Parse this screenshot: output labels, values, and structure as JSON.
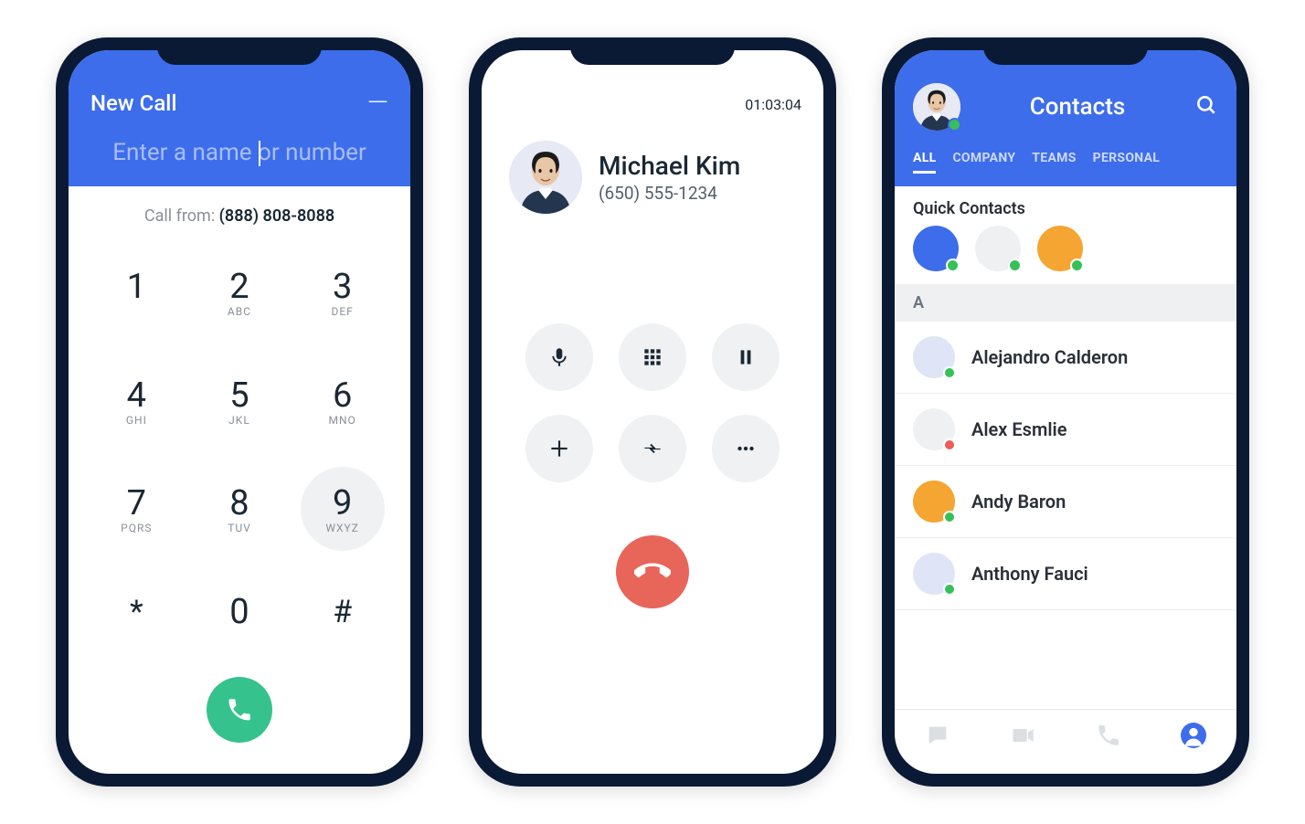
{
  "colors": {
    "brand": "#3D6DEB",
    "callGreen": "#36c28c",
    "hangRed": "#e8655a",
    "presenceGreen": "#36c158",
    "presenceRed": "#ef5a5a",
    "contactOrange": "#f5a531",
    "contactBlue": "#3D6DEB",
    "contactPale": "#dfe4f7",
    "contactGray": "#eef0f2"
  },
  "phone1": {
    "title": "New Call",
    "minimizeGlyph": "—",
    "inputPlaceholder": "Enter a name or number",
    "callFromLabel": "Call from:",
    "callFromNumber": "(888) 808-8088",
    "keys": [
      {
        "digit": "1",
        "letters": ""
      },
      {
        "digit": "2",
        "letters": "ABC"
      },
      {
        "digit": "3",
        "letters": "DEF"
      },
      {
        "digit": "4",
        "letters": "GHI"
      },
      {
        "digit": "5",
        "letters": "JKL"
      },
      {
        "digit": "6",
        "letters": "MNO"
      },
      {
        "digit": "7",
        "letters": "PQRS"
      },
      {
        "digit": "8",
        "letters": "TUV"
      },
      {
        "digit": "9",
        "letters": "WXYZ",
        "highlighted": true
      },
      {
        "digit": "*",
        "letters": "",
        "symbol": true
      },
      {
        "digit": "0",
        "letters": ""
      },
      {
        "digit": "#",
        "letters": "",
        "symbol": true
      }
    ],
    "callButtonIcon": "phone-icon"
  },
  "phone2": {
    "timer": "01:03:04",
    "contactName": "Michael Kim",
    "contactPhone": "(650) 555-1234",
    "controls": [
      {
        "name": "mute-button",
        "icon": "mic-icon"
      },
      {
        "name": "keypad-button",
        "icon": "keypad-icon"
      },
      {
        "name": "hold-button",
        "icon": "pause-icon"
      },
      {
        "name": "add-call-button",
        "icon": "plus-icon"
      },
      {
        "name": "transfer-button",
        "icon": "transfer-icon"
      },
      {
        "name": "more-button",
        "icon": "more-icon"
      }
    ],
    "hangupIcon": "hangup-icon"
  },
  "phone3": {
    "title": "Contacts",
    "tabs": [
      {
        "label": "ALL",
        "active": true
      },
      {
        "label": "COMPANY",
        "active": false
      },
      {
        "label": "TEAMS",
        "active": false
      },
      {
        "label": "PERSONAL",
        "active": false
      }
    ],
    "quickContactsTitle": "Quick Contacts",
    "quickContacts": [
      {
        "color": "#3D6DEB",
        "presence": "green"
      },
      {
        "color": "#eef0f2",
        "presence": "green"
      },
      {
        "color": "#f5a531",
        "presence": "green"
      }
    ],
    "sectionLetter": "A",
    "contacts": [
      {
        "name": "Alejandro Calderon",
        "color": "#dfe4f7",
        "presence": "green"
      },
      {
        "name": "Alex Esmlie",
        "color": "#eef0f2",
        "presence": "red"
      },
      {
        "name": "Andy Baron",
        "color": "#f5a531",
        "presence": "green"
      },
      {
        "name": "Anthony Fauci",
        "color": "#dfe4f7",
        "presence": "green"
      }
    ],
    "bottomNav": [
      {
        "name": "chat-tab",
        "icon": "chat-icon",
        "active": false
      },
      {
        "name": "video-tab",
        "icon": "video-icon",
        "active": false
      },
      {
        "name": "phone-tab",
        "icon": "phone-icon",
        "active": false
      },
      {
        "name": "contacts-tab",
        "icon": "person-icon",
        "active": true
      }
    ]
  }
}
